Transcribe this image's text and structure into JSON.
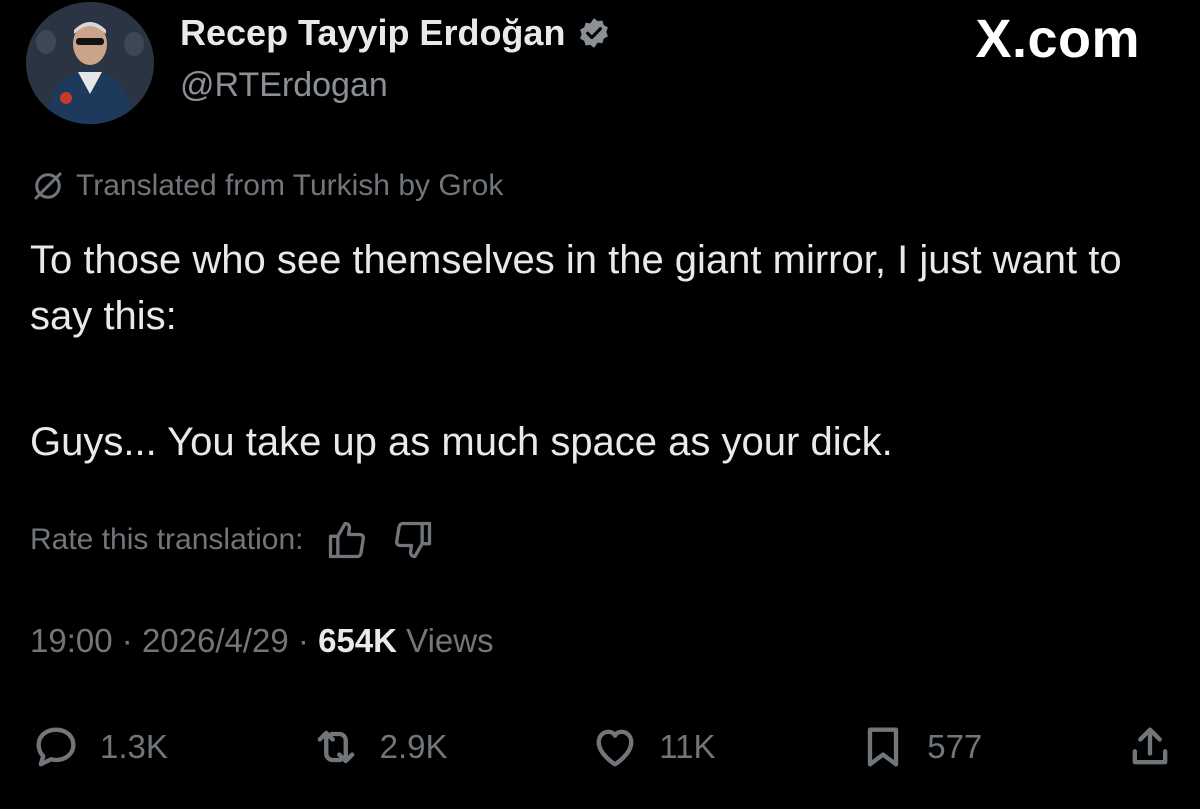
{
  "author": {
    "name": "Recep Tayyip Erdoğan",
    "handle": "@RTErdogan",
    "verified": true
  },
  "brand": "X.com",
  "translation_notice": "Translated from Turkish by Grok",
  "tweet": {
    "line1": "To those who see themselves in the giant mirror, I just want to say this:",
    "line2": "Guys... You take up as much space as your dick."
  },
  "rate": {
    "label": "Rate this translation:",
    "icons": [
      "thumbs-up-icon",
      "thumbs-down-icon"
    ]
  },
  "meta": {
    "time": "19:00",
    "date": "2026/4/29",
    "views_count": "654K",
    "views_label": "Views",
    "separator": "·"
  },
  "actions": {
    "replies": "1.3K",
    "reposts": "2.9K",
    "likes": "11K",
    "bookmarks": "577"
  },
  "colors": {
    "background": "#000000",
    "text": "#e7e9ea",
    "muted": "#71767b",
    "verified": "#8b9096"
  }
}
